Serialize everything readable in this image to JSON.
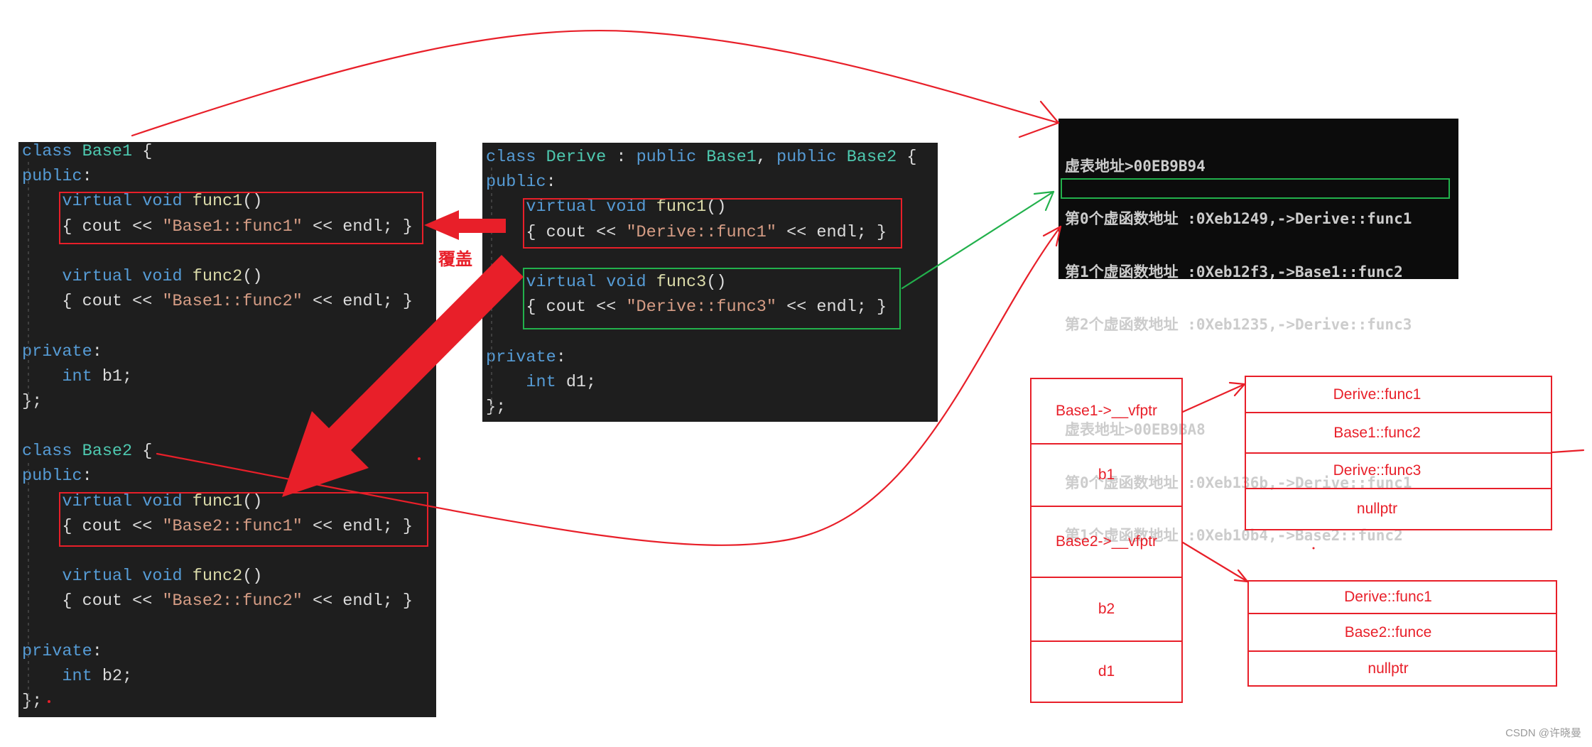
{
  "colors": {
    "annotation_red": "#e81f29",
    "highlight_green": "#22b14c",
    "code_background": "#1e1e1e",
    "console_background": "#0c0c0c",
    "console_text": "#cccccc"
  },
  "left_code": {
    "lines": [
      [
        [
          "class ",
          "#569cd6"
        ],
        [
          "Base1",
          "#4ec9b0"
        ],
        [
          " {",
          "#dcdcdc"
        ]
      ],
      [
        [
          "public",
          "#569cd6"
        ],
        [
          ":",
          "#dcdcdc"
        ]
      ],
      [
        [
          "    virtual void ",
          "#569cd6"
        ],
        [
          "func1",
          "#dcdcaa"
        ],
        [
          "()",
          "#dcdcdc"
        ]
      ],
      [
        [
          "    { cout << ",
          "#dcdcdc"
        ],
        [
          "\"Base1::func1\"",
          "#d69d85"
        ],
        [
          " << endl; }",
          "#dcdcdc"
        ]
      ],
      [],
      [
        [
          "    virtual void ",
          "#569cd6"
        ],
        [
          "func2",
          "#dcdcaa"
        ],
        [
          "()",
          "#dcdcdc"
        ]
      ],
      [
        [
          "    { cout << ",
          "#dcdcdc"
        ],
        [
          "\"Base1::func2\"",
          "#d69d85"
        ],
        [
          " << endl; }",
          "#dcdcdc"
        ]
      ],
      [],
      [
        [
          "private",
          "#569cd6"
        ],
        [
          ":",
          "#dcdcdc"
        ]
      ],
      [
        [
          "    int ",
          "#569cd6"
        ],
        [
          "b1;",
          "#dcdcdc"
        ]
      ],
      [
        [
          "};",
          "#dcdcdc"
        ]
      ],
      [],
      [
        [
          "class ",
          "#569cd6"
        ],
        [
          "Base2",
          "#4ec9b0"
        ],
        [
          " {",
          "#dcdcdc"
        ]
      ],
      [
        [
          "public",
          "#569cd6"
        ],
        [
          ":",
          "#dcdcdc"
        ]
      ],
      [
        [
          "    virtual void ",
          "#569cd6"
        ],
        [
          "func1",
          "#dcdcaa"
        ],
        [
          "()",
          "#dcdcdc"
        ]
      ],
      [
        [
          "    { cout << ",
          "#dcdcdc"
        ],
        [
          "\"Base2::func1\"",
          "#d69d85"
        ],
        [
          " << endl; }",
          "#dcdcdc"
        ]
      ],
      [],
      [
        [
          "    virtual void ",
          "#569cd6"
        ],
        [
          "func2",
          "#dcdcaa"
        ],
        [
          "()",
          "#dcdcdc"
        ]
      ],
      [
        [
          "    { cout << ",
          "#dcdcdc"
        ],
        [
          "\"Base2::func2\"",
          "#d69d85"
        ],
        [
          " << endl; }",
          "#dcdcdc"
        ]
      ],
      [],
      [
        [
          "private",
          "#569cd6"
        ],
        [
          ":",
          "#dcdcdc"
        ]
      ],
      [
        [
          "    int ",
          "#569cd6"
        ],
        [
          "b2;",
          "#dcdcdc"
        ]
      ],
      [
        [
          "};",
          "#dcdcdc"
        ]
      ]
    ]
  },
  "middle_code": {
    "lines": [
      [
        [
          "class ",
          "#569cd6"
        ],
        [
          "Derive",
          "#4ec9b0"
        ],
        [
          " : ",
          "#dcdcdc"
        ],
        [
          "public ",
          "#569cd6"
        ],
        [
          "Base1",
          "#4ec9b0"
        ],
        [
          ", ",
          "#dcdcdc"
        ],
        [
          "public ",
          "#569cd6"
        ],
        [
          "Base2",
          "#4ec9b0"
        ],
        [
          " {",
          "#dcdcdc"
        ]
      ],
      [
        [
          "public",
          "#569cd6"
        ],
        [
          ":",
          "#dcdcdc"
        ]
      ],
      [
        [
          "    virtual void ",
          "#569cd6"
        ],
        [
          "func1",
          "#dcdcaa"
        ],
        [
          "()",
          "#dcdcdc"
        ]
      ],
      [
        [
          "    { cout << ",
          "#dcdcdc"
        ],
        [
          "\"Derive::func1\"",
          "#d69d85"
        ],
        [
          " << endl; }",
          "#dcdcdc"
        ]
      ],
      [],
      [
        [
          "    virtual void ",
          "#569cd6"
        ],
        [
          "func3",
          "#dcdcaa"
        ],
        [
          "()",
          "#dcdcdc"
        ]
      ],
      [
        [
          "    { cout << ",
          "#dcdcdc"
        ],
        [
          "\"Derive::func3\"",
          "#d69d85"
        ],
        [
          " << endl; }",
          "#dcdcdc"
        ]
      ],
      [],
      [
        [
          "private",
          "#569cd6"
        ],
        [
          ":",
          "#dcdcdc"
        ]
      ],
      [
        [
          "    int ",
          "#569cd6"
        ],
        [
          "d1;",
          "#dcdcdc"
        ]
      ],
      [
        [
          "};",
          "#dcdcdc"
        ]
      ]
    ]
  },
  "override_label": "覆盖",
  "console": {
    "vtables": [
      {
        "header": "虚表地址>00EB9B94",
        "entries": [
          "第0个虚函数地址 :0Xeb1249,->Derive::func1",
          "第1个虚函数地址 :0Xeb12f3,->Base1::func2",
          "第2个虚函数地址 :0Xeb1235,->Derive::func3"
        ]
      },
      {
        "header": "虚表地址>00EB9BA8",
        "entries": [
          "第0个虚函数地址 :0Xeb136b,->Derive::func1",
          "第1个虚函数地址 :0Xeb10b4,->Base2::func2"
        ]
      }
    ]
  },
  "object_layout": {
    "fields": [
      "Base1->__vfptr",
      "b1",
      "Base2->__vfptr",
      "b2",
      "d1"
    ]
  },
  "vtable_base1": {
    "entries": [
      "Derive::func1",
      "Base1::func2",
      "Derive::func3",
      "nullptr"
    ]
  },
  "vtable_base2": {
    "entries": [
      "Derive::func1",
      "Base2::funce",
      "nullptr"
    ]
  },
  "watermark": "CSDN @许晓曼"
}
